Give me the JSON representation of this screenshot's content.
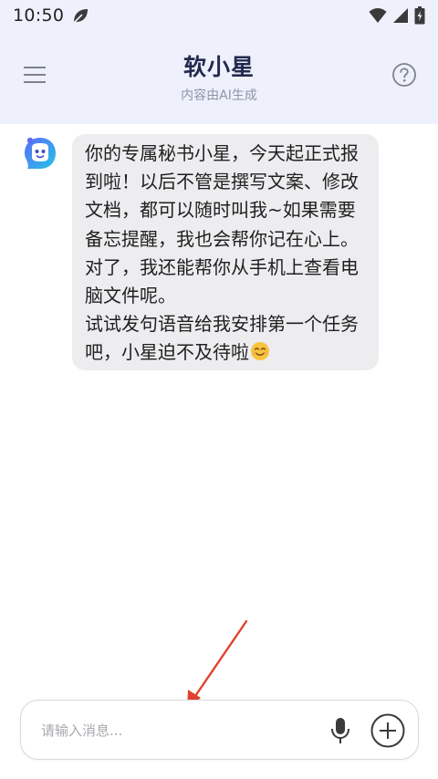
{
  "status_bar": {
    "time": "10:50",
    "icons": [
      "leaf-icon",
      "wifi-icon",
      "signal-icon",
      "battery-icon"
    ]
  },
  "header": {
    "title": "软小星",
    "subtitle": "内容由AI生成",
    "menu_icon": "hamburger-menu-icon",
    "help_icon": "help-circle-icon"
  },
  "chat": {
    "messages": [
      {
        "sender": "bot",
        "avatar_icon": "bot-avatar-icon",
        "lines": [
          "你的专属秘书小星，今天起正式报",
          "到啦！以后不管是撰写文案、修改",
          "文档，都可以随时叫我~如果需要",
          "备忘提醒，我也会帮你记在心上。",
          "对了，我还能帮你从手机上查看电",
          "脑文件呢。",
          "试试发句语音给我安排第一个任务",
          "吧，小星迫不及待啦"
        ],
        "emoji": "smiling-face-emoji"
      }
    ]
  },
  "input": {
    "placeholder": "请输入消息...",
    "value": "",
    "mic_icon": "microphone-icon",
    "plus_icon": "plus-circle-icon"
  },
  "colors": {
    "header_bg": "#eef1fb",
    "title": "#232a4e",
    "bubble_bg": "#ededf0",
    "arrow": "#e0432f",
    "avatar_gradient_start": "#5b6cf5",
    "avatar_gradient_end": "#27c3e8"
  }
}
